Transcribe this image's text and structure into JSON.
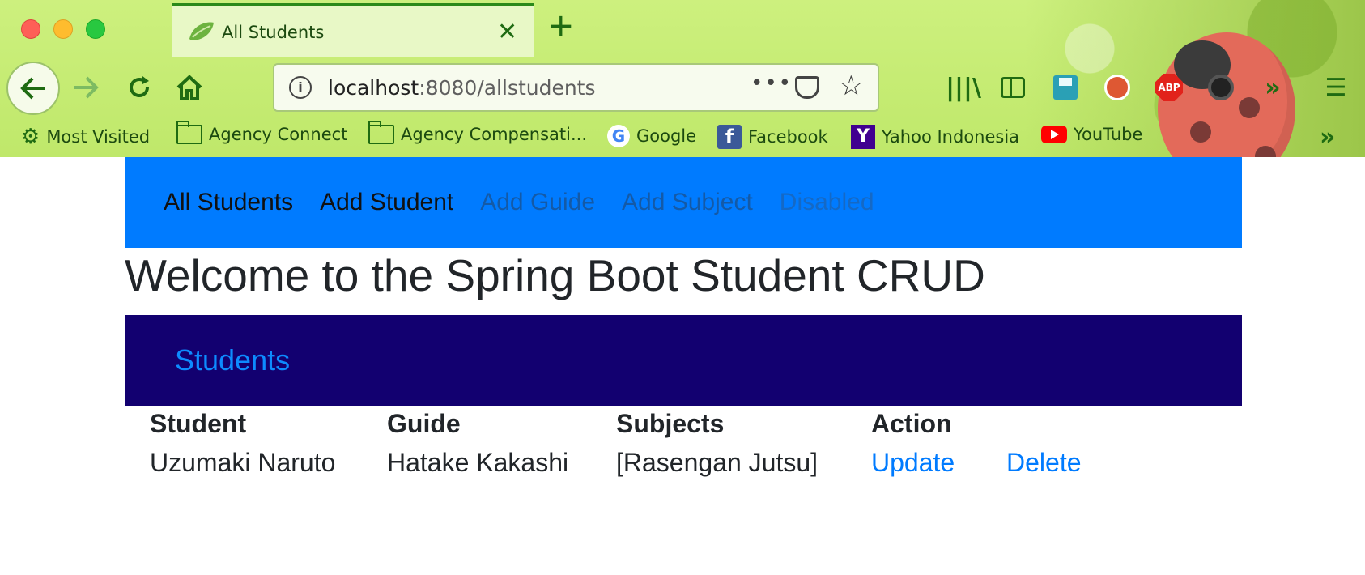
{
  "browser": {
    "tab_title": "All Students",
    "url_host": "localhost",
    "url_rest": ":8080/allstudents",
    "bookmarks": [
      {
        "label": "Most Visited",
        "icon": "gear-icon"
      },
      {
        "label": "Agency Connect",
        "icon": "folder-icon"
      },
      {
        "label": "Agency Compensati...",
        "icon": "folder-icon"
      },
      {
        "label": "Google",
        "icon": "google-icon"
      },
      {
        "label": "Facebook",
        "icon": "facebook-icon"
      },
      {
        "label": "Yahoo Indonesia",
        "icon": "yahoo-icon"
      },
      {
        "label": "YouTube",
        "icon": "youtube-icon"
      }
    ],
    "abp_label": "ABP"
  },
  "navbar": {
    "links": [
      {
        "label": "All Students",
        "state": "active"
      },
      {
        "label": "Add Student",
        "state": "active"
      },
      {
        "label": "Add Guide",
        "state": "muted"
      },
      {
        "label": "Add Subject",
        "state": "muted"
      },
      {
        "label": "Disabled",
        "state": "disabled"
      }
    ],
    "color": "#007bff"
  },
  "page": {
    "title": "Welcome to the Spring Boot Student CRUD",
    "section_title": "Students",
    "section_color": "#120070"
  },
  "table": {
    "headers": [
      "Student",
      "Guide",
      "Subjects",
      "Action"
    ],
    "rows": [
      {
        "student": "Uzumaki Naruto",
        "guide": "Hatake Kakashi",
        "subjects": "[Rasengan Jutsu]",
        "update": "Update",
        "delete": "Delete"
      }
    ]
  }
}
